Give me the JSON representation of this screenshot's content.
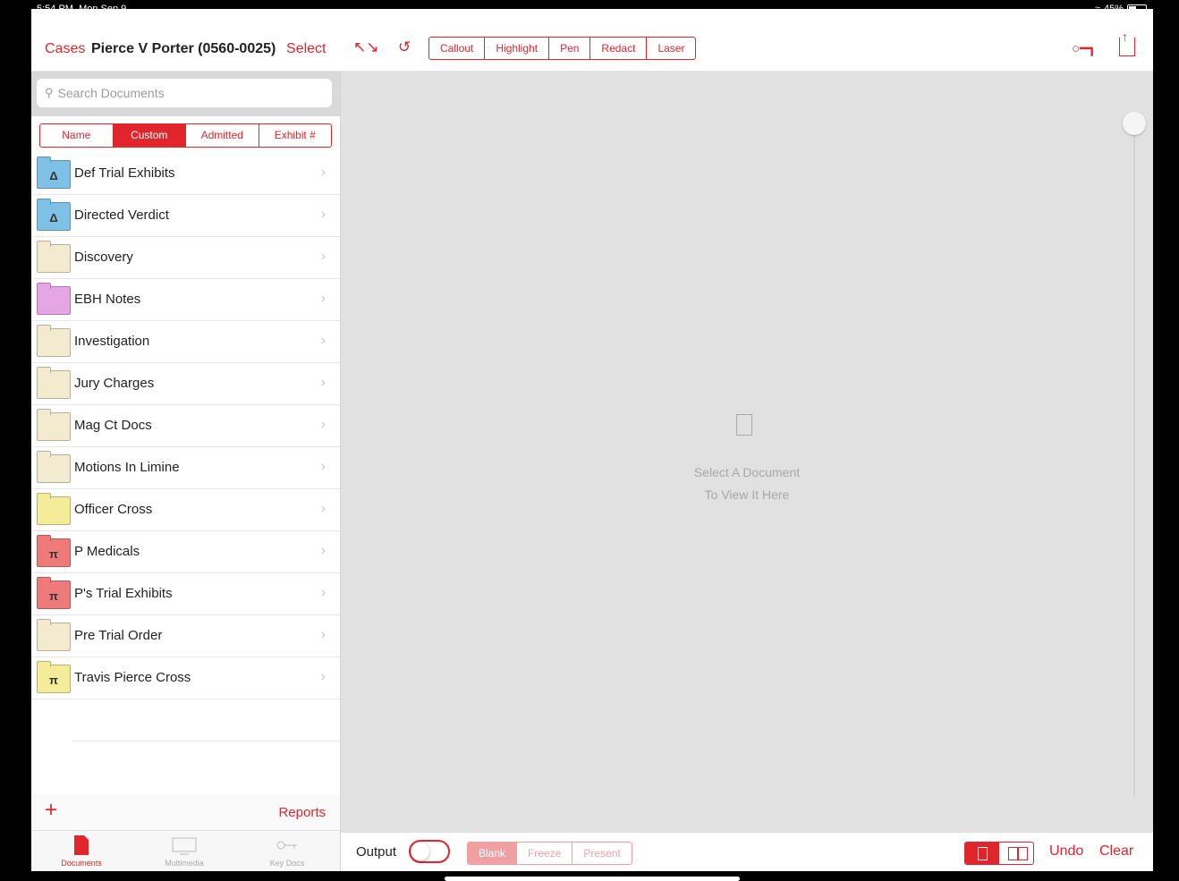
{
  "status": {
    "time": "5:54 PM",
    "date": "Mon Sep 9",
    "battery": "45%",
    "wifi_icon": "wifi-icon"
  },
  "header": {
    "back_label": "Cases",
    "case_title": "Pierce V Porter (0560-0025)",
    "select_label": "Select",
    "tools": [
      "Callout",
      "Highlight",
      "Pen",
      "Redact",
      "Laser"
    ]
  },
  "search": {
    "placeholder": "Search Documents"
  },
  "sort_tabs": [
    "Name",
    "Custom",
    "Admitted",
    "Exhibit #"
  ],
  "sort_active": "Custom",
  "folders": [
    {
      "label": "Def Trial Exhibits",
      "color": "#7fc1e6",
      "glyph": "Δ"
    },
    {
      "label": "Directed Verdict",
      "color": "#7fc1e6",
      "glyph": "Δ"
    },
    {
      "label": "Discovery",
      "color": "#f3ebd0",
      "glyph": ""
    },
    {
      "label": "EBH Notes",
      "color": "#e6a6e6",
      "glyph": ""
    },
    {
      "label": "Investigation",
      "color": "#f3ebd0",
      "glyph": ""
    },
    {
      "label": "Jury Charges",
      "color": "#f3ebd0",
      "glyph": ""
    },
    {
      "label": "Mag Ct Docs",
      "color": "#f3ebd0",
      "glyph": ""
    },
    {
      "label": "Motions In Limine",
      "color": "#f3ebd0",
      "glyph": ""
    },
    {
      "label": "Officer Cross",
      "color": "#f5ec9a",
      "glyph": ""
    },
    {
      "label": "P Medicals",
      "color": "#ee7a7a",
      "glyph": "π"
    },
    {
      "label": "P's Trial Exhibits",
      "color": "#ee7a7a",
      "glyph": "π"
    },
    {
      "label": "Pre Trial Order",
      "color": "#f3ebd0",
      "glyph": ""
    },
    {
      "label": "Travis Pierce Cross",
      "color": "#f5ec9a",
      "glyph": "π"
    }
  ],
  "sidebar_footer": {
    "add_icon": "plus-icon",
    "reports_label": "Reports"
  },
  "tabs": [
    {
      "label": "Documents",
      "icon": "document-icon",
      "active": true
    },
    {
      "label": "Multimedia",
      "icon": "monitor-icon",
      "active": false
    },
    {
      "label": "Key Docs",
      "icon": "key-icon",
      "active": false
    }
  ],
  "viewer": {
    "line1": "Select A Document",
    "line2": "To View It Here"
  },
  "bottom": {
    "output_label": "Output",
    "output_modes": [
      "Blank",
      "Freeze",
      "Present"
    ],
    "output_active": "Blank",
    "undo_label": "Undo",
    "clear_label": "Clear"
  },
  "colors": {
    "accent": "#e0252c",
    "viewer_bg": "#e1e1e1"
  }
}
